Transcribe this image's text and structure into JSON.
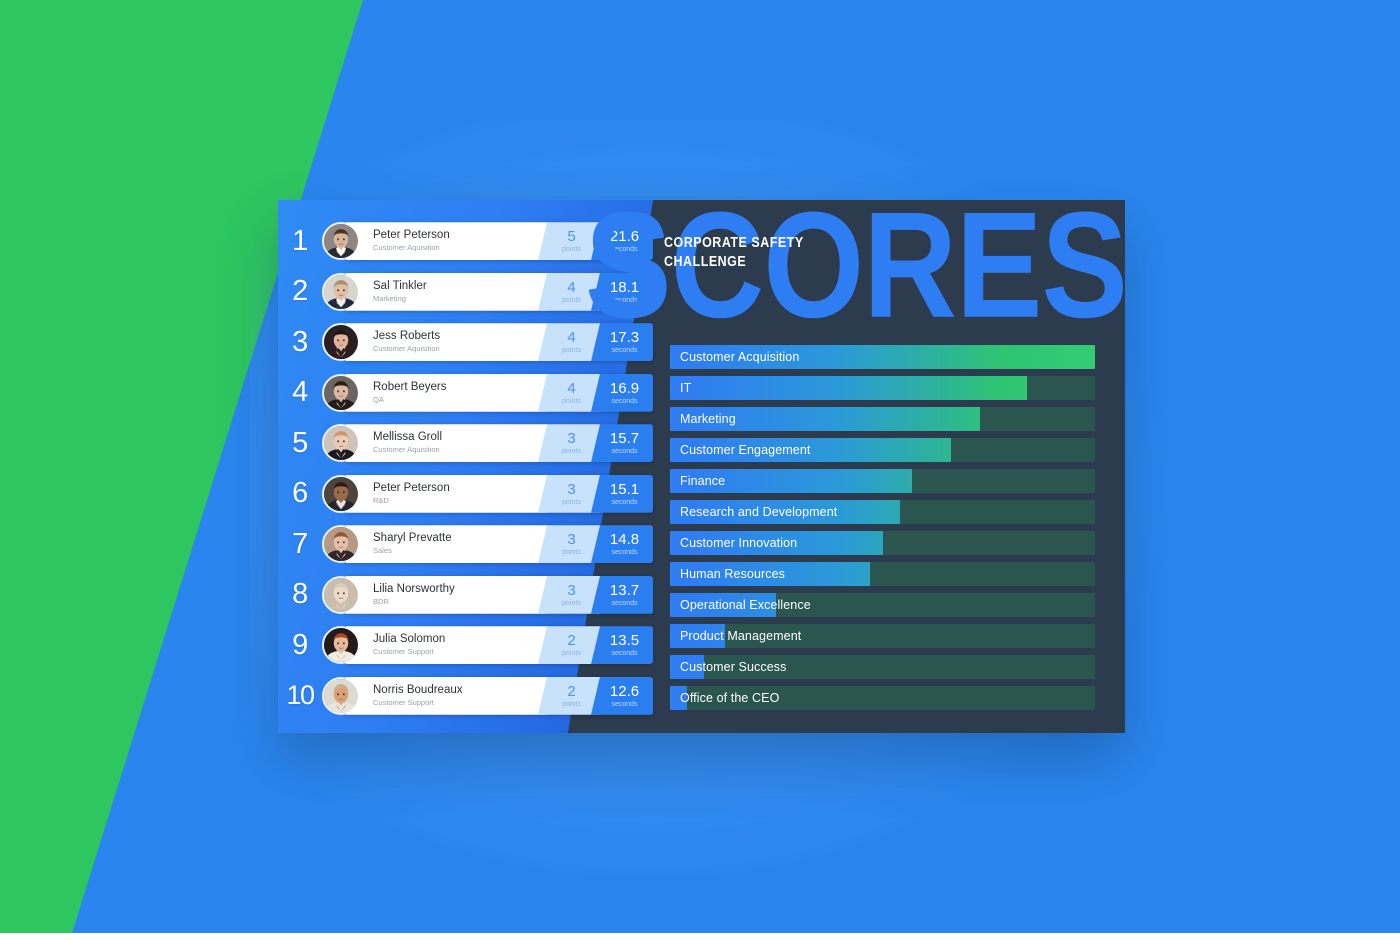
{
  "background": {
    "green": "#2ec65f",
    "blue": "#2a86ee"
  },
  "card": {
    "bg": "#2c3c4e",
    "accent_blue": "#2f7df2",
    "accent_green": "#2ec65f"
  },
  "header": {
    "subtitle_line1": "CORPORATE SAFETY",
    "subtitle_line2": "CHALLENGE",
    "title": "SCORES"
  },
  "leaderboard": {
    "points_label": "points",
    "seconds_label": "seconds",
    "rows": [
      {
        "rank": "1",
        "name": "Peter Peterson",
        "dept": "Customer Aquisition",
        "points": "5",
        "seconds": "21.6"
      },
      {
        "rank": "2",
        "name": "Sal Tinkler",
        "dept": "Marketing",
        "points": "4",
        "seconds": "18.1"
      },
      {
        "rank": "3",
        "name": "Jess Roberts",
        "dept": "Customer Aquisition",
        "points": "4",
        "seconds": "17.3"
      },
      {
        "rank": "4",
        "name": "Robert Beyers",
        "dept": "QA",
        "points": "4",
        "seconds": "16.9"
      },
      {
        "rank": "5",
        "name": "Mellissa Groll",
        "dept": "Customer Aquisition",
        "points": "3",
        "seconds": "15.7"
      },
      {
        "rank": "6",
        "name": "Peter Peterson",
        "dept": "R&D",
        "points": "3",
        "seconds": "15.1"
      },
      {
        "rank": "7",
        "name": "Sharyl Prevatte",
        "dept": "Sales",
        "points": "3",
        "seconds": "14.8"
      },
      {
        "rank": "8",
        "name": "Lilia Norsworthy",
        "dept": "BDR",
        "points": "3",
        "seconds": "13.7"
      },
      {
        "rank": "9",
        "name": "Julia Solomon",
        "dept": "Customer Support",
        "points": "2",
        "seconds": "13.5"
      },
      {
        "rank": "10",
        "name": "Norris Boudreaux",
        "dept": "Customer Support",
        "points": "2",
        "seconds": "12.6"
      }
    ]
  },
  "chart_data": {
    "type": "bar",
    "title": "SCORES",
    "xlabel": "",
    "ylabel": "",
    "grid": false,
    "legend": "none",
    "orientation": "horizontal",
    "xlim": [
      0,
      100
    ],
    "categories": [
      "Customer Acquisition",
      "IT",
      "Marketing",
      "Customer Engagement",
      "Finance",
      "Research and Development",
      "Customer Innovation",
      "Human Resources",
      "Operational Excellence",
      "Product Management",
      "Customer Success",
      "Office of the CEO"
    ],
    "values": [
      100,
      84,
      73,
      66,
      57,
      54,
      50,
      47,
      25,
      13,
      8,
      4
    ]
  },
  "avatars": [
    {
      "skin": "#d8b49a",
      "hair": "#4a3527",
      "suit": "#2a2a30",
      "shirt": "#ffffff",
      "bg": "#8d8682"
    },
    {
      "skin": "#e0c0a4",
      "hair": "#a9926f",
      "suit": "#1f2b3c",
      "shirt": "#f2f2f2",
      "bg": "#d8d4cf"
    },
    {
      "skin": "#e3b49c",
      "hair": "#1b1416",
      "suit": "#2b1d22",
      "shirt": "#2b1d22",
      "bg": "#2a2024"
    },
    {
      "skin": "#dcb7a2",
      "hair": "#2b1d14",
      "suit": "#231c1c",
      "shirt": "#231c1c",
      "bg": "#6e6563"
    },
    {
      "skin": "#eccbb4",
      "hair": "#c79a6a",
      "suit": "#1a1a20",
      "shirt": "#1a1a20",
      "bg": "#cfc4bb"
    },
    {
      "skin": "#9b6a4b",
      "hair": "#2b1c14",
      "suit": "#25262b",
      "shirt": "#e8e8e8",
      "bg": "#4c443f"
    },
    {
      "skin": "#e9c0a7",
      "hair": "#8a5a3c",
      "suit": "#30262a",
      "shirt": "#30262a",
      "bg": "#b79a84"
    },
    {
      "skin": "#eedac9",
      "hair": "#d9cdbd",
      "suit": "#cdbfae",
      "shirt": "#cdbfae",
      "bg": "#c9bdae"
    },
    {
      "skin": "#e7b89c",
      "hair": "#a5482a",
      "suit": "#f0ece6",
      "shirt": "#f0ece6",
      "bg": "#231b18"
    },
    {
      "skin": "#d8a176",
      "hair": "#c9b089",
      "suit": "#e9e4dc",
      "shirt": "#e9e4dc",
      "bg": "#dedad2"
    }
  ]
}
